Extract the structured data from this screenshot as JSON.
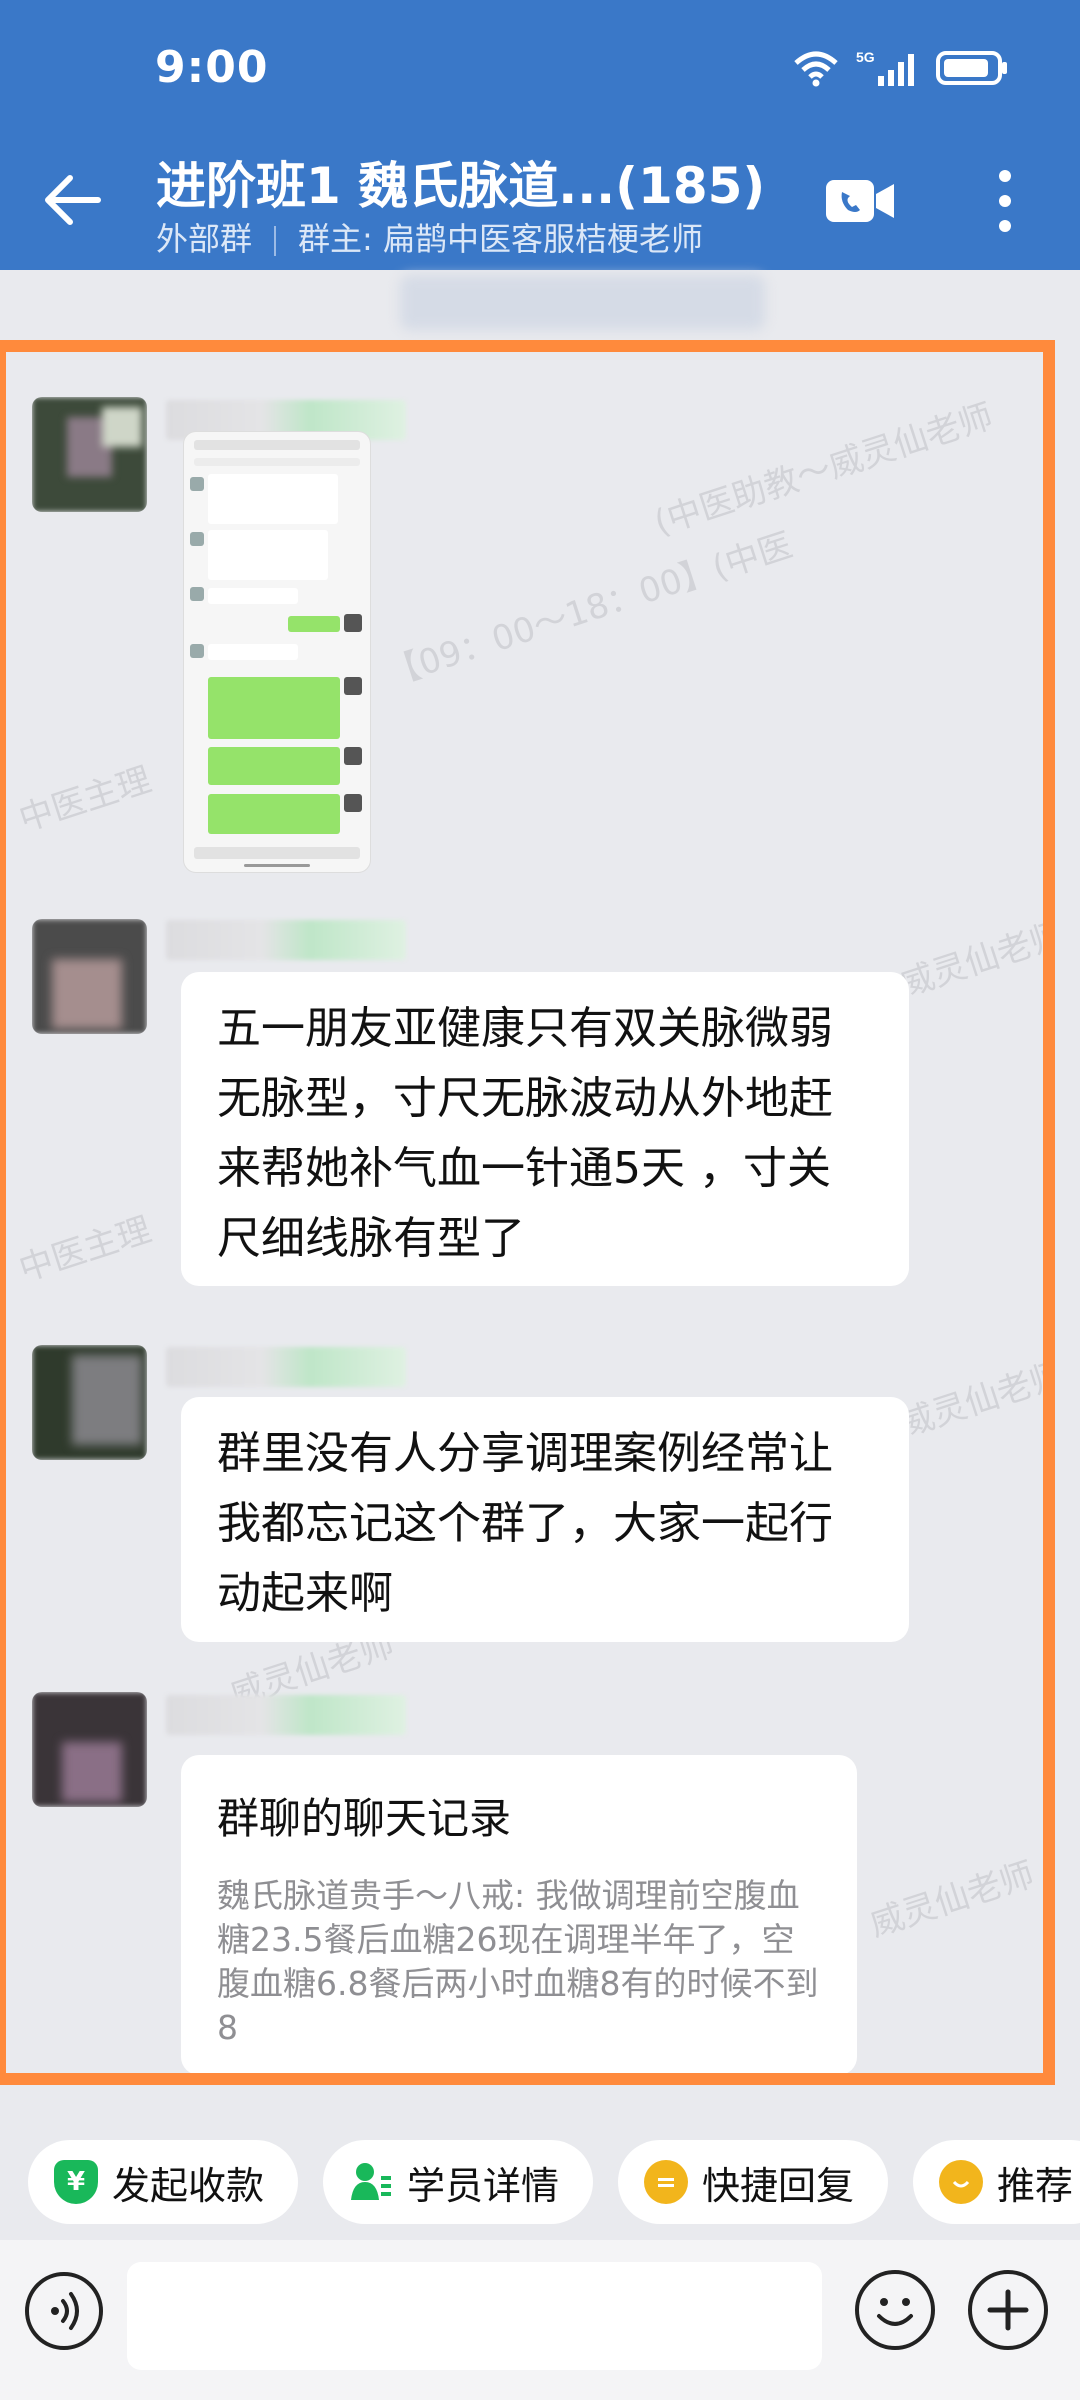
{
  "status": {
    "time": "9:00",
    "network": "5G"
  },
  "header": {
    "title": "进阶班1  魏氏脉道...(185)",
    "subtitle_left": "外部群",
    "subtitle_right": "群主: 扁鹊中医客服桔梗老师"
  },
  "watermark": {
    "text1": "(中医助教～威灵仙老师",
    "text2": "【09：00～18：00】(中医",
    "text3": "中医主理",
    "text4": "威灵仙老师"
  },
  "messages": [
    {
      "type": "image",
      "sender": "",
      "caption": ""
    },
    {
      "type": "text",
      "text": "五一朋友亚健康只有双关脉微弱无脉型，寸尺无脉波动从外地赶来帮她补气血一针通5天 ，寸关尺细线脉有型了"
    },
    {
      "type": "text",
      "text": "群里没有人分享调理案例经常让我都忘记这个群了，大家一起行动起来啊"
    },
    {
      "type": "record",
      "title": "群聊的聊天记录",
      "body": "魏氏脉道贵手～八戒: 我做调理前空腹血糖23.5餐后血糖26现在调理半年了，空腹血糖6.8餐后两小时血糖8有的时候不到8"
    }
  ],
  "quick_actions": [
    {
      "label": "发起收款",
      "icon": "payment-shield-icon",
      "color": "#19b85a"
    },
    {
      "label": "学员详情",
      "icon": "student-profile-icon",
      "color": "#19b85a"
    },
    {
      "label": "快捷回复",
      "icon": "quick-reply-icon",
      "color": "#f2b51c"
    },
    {
      "label": "推荐",
      "icon": "recommend-icon",
      "color": "#f2b51c"
    }
  ],
  "input": {
    "placeholder": ""
  },
  "colors": {
    "header": "#3a78c8",
    "frame": "#ff8a3c",
    "background": "#e9eaee"
  }
}
